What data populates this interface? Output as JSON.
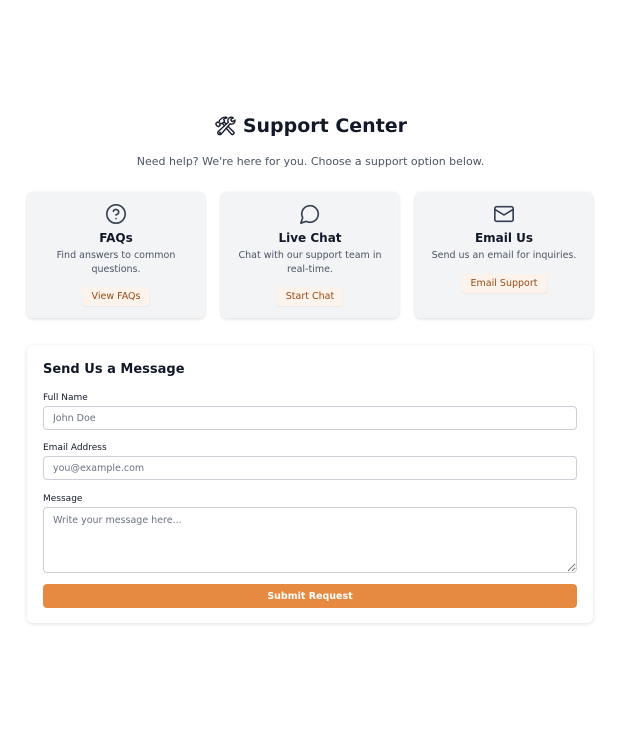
{
  "header": {
    "title": "Support Center",
    "subtitle": "Need help? We're here for you. Choose a support option below."
  },
  "options": [
    {
      "icon": "question-circle-icon",
      "title": "FAQs",
      "description": "Find answers to common questions.",
      "button": "View FAQs"
    },
    {
      "icon": "chat-bubble-icon",
      "title": "Live Chat",
      "description": "Chat with our support team in real-time.",
      "button": "Start Chat"
    },
    {
      "icon": "envelope-icon",
      "title": "Email Us",
      "description": "Send us an email for inquiries.",
      "button": "Email Support"
    }
  ],
  "form": {
    "title": "Send Us a Message",
    "name_label": "Full Name",
    "name_placeholder": "John Doe",
    "email_label": "Email Address",
    "email_placeholder": "you@example.com",
    "message_label": "Message",
    "message_placeholder": "Write your message here...",
    "submit": "Submit Request"
  },
  "colors": {
    "accent": "#e68a42",
    "button_text": "#9a4b16",
    "card_bg": "#f3f4f6"
  }
}
